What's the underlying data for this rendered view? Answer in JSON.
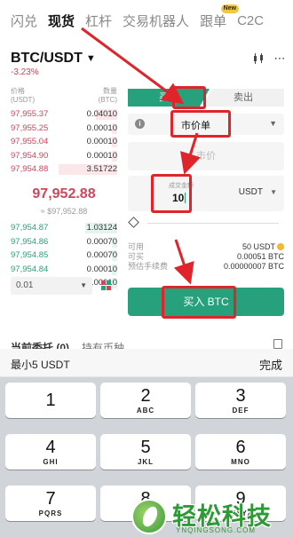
{
  "top_tabs": [
    "闪兑",
    "现货",
    "杠杆",
    "交易机器人",
    "跟单",
    "C2C"
  ],
  "top_tabs_active": "现货",
  "top_tabs_badge": "New",
  "pair": {
    "name": "BTC/USDT",
    "change": "-3.23%"
  },
  "orderbook": {
    "price_header": "价格\n(USDT)",
    "qty_header": "数量\n(BTC)",
    "asks": [
      {
        "price": "97,955.37",
        "qty": "0.04010",
        "depth": 0.2
      },
      {
        "price": "97,955.25",
        "qty": "0.00010",
        "depth": 0.05
      },
      {
        "price": "97,955.04",
        "qty": "0.00010",
        "depth": 0.05
      },
      {
        "price": "97,954.90",
        "qty": "0.00010",
        "depth": 0.05
      },
      {
        "price": "97,954.88",
        "qty": "3.51722",
        "depth": 0.55
      }
    ],
    "mid_price": "97,952.88",
    "mid_sub": "≈ $97,952.88",
    "bids": [
      {
        "price": "97,954.87",
        "qty": "1.03124",
        "depth": 0.3
      },
      {
        "price": "97,954.86",
        "qty": "0.00070",
        "depth": 0.05
      },
      {
        "price": "97,954.85",
        "qty": "0.00070",
        "depth": 0.05
      },
      {
        "price": "97,954.84",
        "qty": "0.00010",
        "depth": 0.05
      },
      {
        "price": "97,954.83",
        "qty": "0.00010",
        "depth": 0.05
      }
    ],
    "precision": "0.01"
  },
  "trade": {
    "buy_tab": "买入",
    "sell_tab": "卖出",
    "order_type": "市价单",
    "price_placeholder": "市价",
    "amount_label": "成交金额",
    "amount_value": "10",
    "amount_unit": "USDT",
    "available_label": "可用",
    "available_value": "50 USDT",
    "can_buy_label": "可买",
    "can_buy_value": "0.00051 BTC",
    "fee_label": "预估手续费",
    "fee_value": "0.00000007 BTC",
    "submit_label": "买入 BTC"
  },
  "orders_strip": {
    "tab1": "当前委托 (0)",
    "tab2": "持有币种"
  },
  "keyboard": {
    "hint": "最小5 USDT",
    "done": "完成",
    "keys": [
      {
        "n": "1",
        "l": ""
      },
      {
        "n": "2",
        "l": "ABC"
      },
      {
        "n": "3",
        "l": "DEF"
      },
      {
        "n": "4",
        "l": "GHI"
      },
      {
        "n": "5",
        "l": "JKL"
      },
      {
        "n": "6",
        "l": "MNO"
      },
      {
        "n": "7",
        "l": "PQRS"
      },
      {
        "n": "8",
        "l": "TUV"
      },
      {
        "n": "9",
        "l": "WXYZ"
      }
    ]
  },
  "watermark": {
    "text": "轻松科技",
    "sub": "YNQINGSONG.COM"
  },
  "colors": {
    "buy_green": "#26a17b",
    "sell_red": "#d0455b",
    "annotation_red": "#e0242b"
  }
}
